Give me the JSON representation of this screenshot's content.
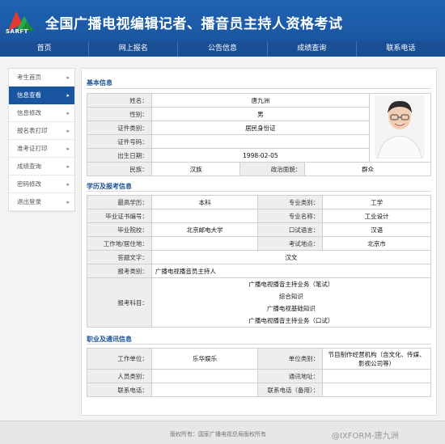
{
  "header": {
    "logo_text": "SARFT",
    "title": "全国广播电视编辑记者、播音员主持人资格考试"
  },
  "nav": [
    "首页",
    "网上报名",
    "公告信息",
    "成绩查询",
    "联系电话"
  ],
  "sidebar": [
    {
      "label": "考生首页",
      "active": false
    },
    {
      "label": "信息查看",
      "active": true
    },
    {
      "label": "信息修改",
      "active": false
    },
    {
      "label": "报名表打印",
      "active": false
    },
    {
      "label": "准考证打印",
      "active": false
    },
    {
      "label": "成绩查询",
      "active": false
    },
    {
      "label": "密码修改",
      "active": false
    },
    {
      "label": "退出登录",
      "active": false
    }
  ],
  "basic": {
    "section_title": "基本信息",
    "name_label": "姓名：",
    "name": "唐九洲",
    "gender_label": "性别：",
    "gender": "男",
    "idtype_label": "证件类别：",
    "idtype": "居民身份证",
    "idno_label": "证件号码：",
    "idno": "",
    "birth_label": "出生日期：",
    "birth": "1998-02-05",
    "ethnic_label": "民族：",
    "ethnic": "汉族",
    "political_label": "政治面貌：",
    "political": "群众"
  },
  "education": {
    "section_title": "学历及报考信息",
    "degree_label": "最高学历：",
    "degree": "本科",
    "major_type_label": "专业类别：",
    "major_type": "工学",
    "cert_label": "毕业证书编号：",
    "cert": "",
    "major_label": "专业名称：",
    "major": "工业设计",
    "school_label": "毕业院校：",
    "school": "北京邮电大学",
    "lang_label": "口试语言：",
    "lang": "汉语",
    "residence_label": "工作地/居住地：",
    "residence": "",
    "site_label": "考试地点：",
    "site": "北京市",
    "answer_lang_label": "答题文字：",
    "answer_lang": "汉文",
    "exam_type_label": "报考类别：",
    "exam_type": "广播电视播音员主持人",
    "subjects_label": "报考科目：",
    "subjects": [
      "广播电视播音主持业务（笔试）",
      "综合知识",
      "广播电视基础知识",
      "广播电视播音主持业务（口试）"
    ]
  },
  "contact": {
    "section_title": "职业及通讯信息",
    "employer_label": "工作单位：",
    "employer": "乐华娱乐",
    "employer_type_label": "单位类别：",
    "employer_type": "节目制作经营机构（含文化、传媒、影视公司等）",
    "person_type_label": "人员类别：",
    "person_type": "",
    "address_label": "通讯地址：",
    "address": "",
    "phone_label": "联系电话：",
    "phone": "",
    "phone2_label": "联系电话（备用）：",
    "phone2": ""
  },
  "footer": {
    "copyright": "版权所有：国家广播电视总局版权所有",
    "watermark": "@IXFORM-唐九洲"
  },
  "colors": {
    "header_blue": "#1f63b3",
    "nav_blue": "#1a4f95",
    "section_blue": "#1a4f95"
  }
}
